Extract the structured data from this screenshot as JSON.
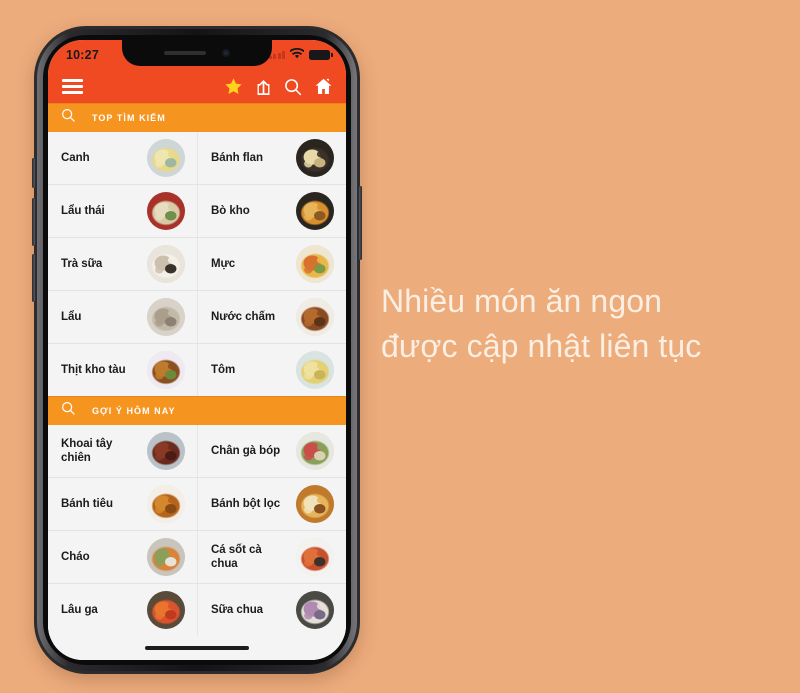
{
  "background_color": "#edac7c",
  "promo": {
    "line1": "Nhiều món ăn ngon",
    "line2": "được cập nhật liên tục",
    "color": "#fbeee2"
  },
  "phone": {
    "status_bar": {
      "time": "10:27",
      "signal_icon": "signal-bars-icon",
      "wifi_icon": "wifi-icon",
      "battery_icon": "battery-icon"
    },
    "app_bar": {
      "background_color": "#f04a23",
      "menu_icon": "hamburger-menu-icon",
      "actions": [
        {
          "icon": "star-icon",
          "color": "#ffd21e"
        },
        {
          "icon": "share-upload-icon",
          "color": "#ffffff"
        },
        {
          "icon": "search-icon",
          "color": "#ffffff"
        },
        {
          "icon": "home-icon",
          "color": "#ffffff"
        }
      ]
    },
    "home_indicator": "home-indicator-bar"
  },
  "sections": [
    {
      "id": "top-tim-kiem",
      "title": "TOP TÌM KIẾM",
      "icon": "search-icon",
      "background_color": "#f5941e",
      "rows": [
        [
          {
            "name": "Canh",
            "thumb": "soup-bowl-thumb"
          },
          {
            "name": "Bánh flan",
            "thumb": "flan-tray-thumb"
          }
        ],
        [
          {
            "name": "Lẩu thái",
            "thumb": "thai-hotpot-thumb"
          },
          {
            "name": "Bò kho",
            "thumb": "beef-stew-thumb"
          }
        ],
        [
          {
            "name": "Trà sữa",
            "thumb": "milk-tea-thumb"
          },
          {
            "name": "Mực",
            "thumb": "squid-dish-thumb"
          }
        ],
        [
          {
            "name": "Lẩu",
            "thumb": "hotpot-thumb"
          },
          {
            "name": "Nước chấm",
            "thumb": "dipping-sauce-thumb"
          }
        ],
        [
          {
            "name": "Thịt kho tàu",
            "thumb": "braised-pork-thumb"
          },
          {
            "name": "Tôm",
            "thumb": "shrimp-dish-thumb"
          }
        ]
      ]
    },
    {
      "id": "goi-y-hom-nay",
      "title": "GỢI Ý HÔM NAY",
      "icon": "search-icon",
      "background_color": "#f5941e",
      "rows": [
        [
          {
            "name": "Khoai tây chiên",
            "thumb": "french-fries-thumb"
          },
          {
            "name": "Chân gà bóp",
            "thumb": "chicken-feet-salad-thumb"
          }
        ],
        [
          {
            "name": "Bánh tiêu",
            "thumb": "donut-thumb"
          },
          {
            "name": "Bánh bột lọc",
            "thumb": "tapioca-dumpling-thumb"
          }
        ],
        [
          {
            "name": "Cháo",
            "thumb": "porridge-thumb"
          },
          {
            "name": "Cá sốt cà chua",
            "thumb": "fish-tomato-sauce-thumb"
          }
        ],
        [
          {
            "name": "Lâu ga",
            "thumb": "chicken-hotpot-thumb"
          },
          {
            "name": "Sữa chua",
            "thumb": "yogurt-thumb"
          }
        ]
      ]
    }
  ]
}
